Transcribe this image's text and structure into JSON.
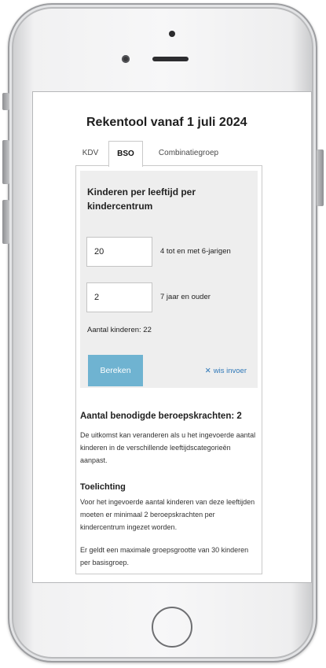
{
  "app": {
    "title": "Rekentool vanaf 1 juli 2024"
  },
  "tabs": [
    {
      "label": "KDV"
    },
    {
      "label": "BSO",
      "active": true
    },
    {
      "label": "Combinatiegroep"
    }
  ],
  "calculator": {
    "heading": "Kinderen per leeftijd per kindercentrum",
    "inputs": [
      {
        "value": "20",
        "label": "4 tot en met 6-jarigen"
      },
      {
        "value": "2",
        "label": "7 jaar en ouder"
      }
    ],
    "total": "Aantal kinderen: 22",
    "calculate_label": "Bereken",
    "clear_label": "wis invoer"
  },
  "result": {
    "heading": "Aantal benodigde beroepskrachten: 2",
    "note": "De uitkomst kan veranderen als u het ingevoerde aantal kinderen in de verschillende leeftijdscategorieën aanpast.",
    "explanation_heading": "Toelichting",
    "explanation": "Voor het ingevoerde aantal kinderen van deze leeftijden moeten er minimaal 2 beroepskrachten per kindercentrum ingezet worden.",
    "group_note": "Er geldt een maximale groepsgrootte van 30 kinderen per basisgroep."
  },
  "colors": {
    "accent_button": "#6fb3d1",
    "link": "#2f78b8",
    "panel_bg": "#eeeeee"
  },
  "icons": {
    "clear": "close-icon"
  }
}
